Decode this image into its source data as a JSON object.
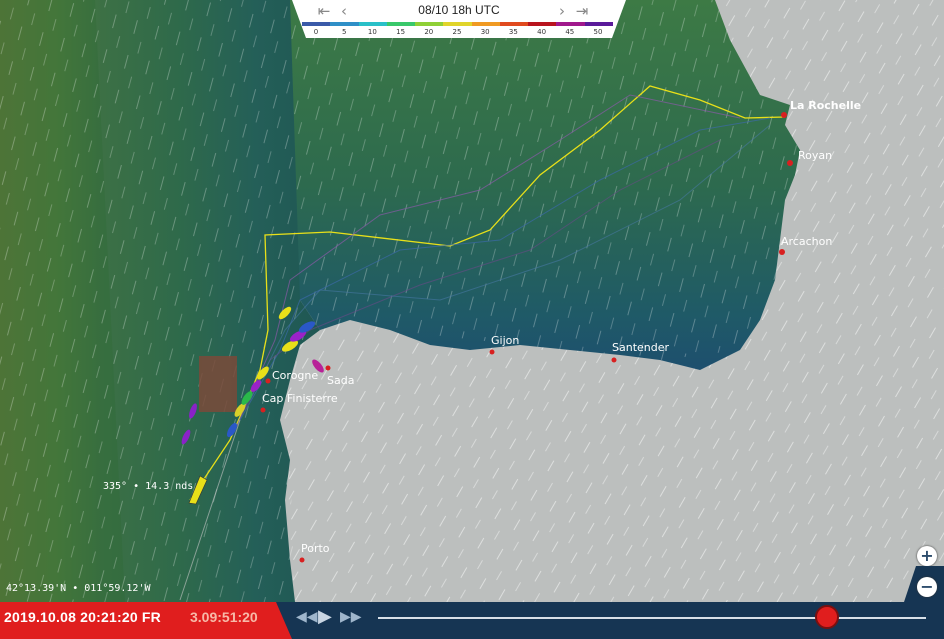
{
  "forecast": {
    "time": "08/10 18h UTC",
    "scale_labels": [
      "0",
      "5",
      "10",
      "15",
      "20",
      "25",
      "30",
      "35",
      "40",
      "45",
      "50"
    ],
    "scale_colors": [
      "#3a5aa8",
      "#2f8fc7",
      "#29c0c8",
      "#39c86a",
      "#8fd036",
      "#e0d42a",
      "#f09a22",
      "#e04a1e",
      "#b8141e",
      "#a0188c",
      "#5a1a9a"
    ]
  },
  "icons": {
    "first": "skip-to-start-icon",
    "prev": "step-back-icon",
    "next": "step-forward-icon",
    "last": "skip-to-end-icon"
  },
  "places": [
    {
      "name": "La Rochelle"
    },
    {
      "name": "Royan"
    },
    {
      "name": "Arcachon"
    },
    {
      "name": "Gijon"
    },
    {
      "name": "Santender"
    },
    {
      "name": "Corogne"
    },
    {
      "name": "Sada"
    },
    {
      "name": "Cap Finisterre"
    },
    {
      "name": "Porto"
    }
  ],
  "boat": {
    "info": "335° • 14.3 nds",
    "color": "#e8e019"
  },
  "cursor_coords": "42°13.39'N • 011°59.12'W",
  "playback": {
    "datetime": "2019.10.08 20:21:20 FR",
    "elapsed": "3.09:51:20",
    "progress": 0.82
  },
  "zoom": {
    "in": "+",
    "out": "−"
  },
  "colors": {
    "accent": "#e01e1e",
    "bar": "#163553",
    "land": "#b9bcbb",
    "sea_green": "#3a6b3a",
    "sea_teal": "#1f5a5a"
  }
}
